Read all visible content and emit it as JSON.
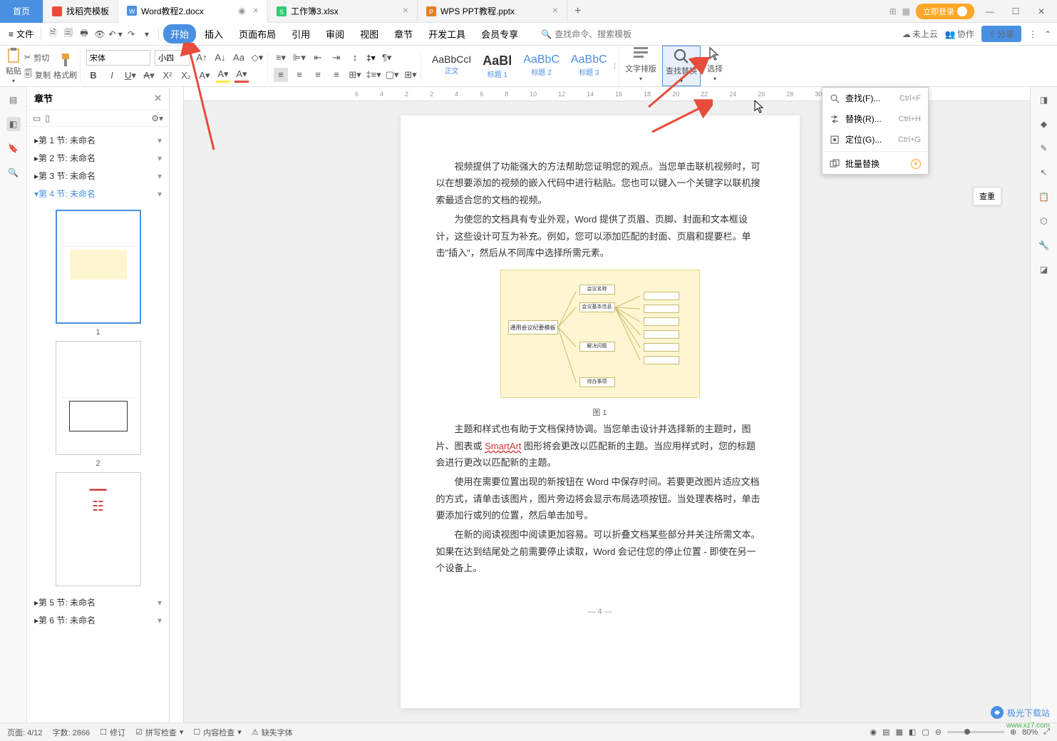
{
  "titlebar": {
    "home": "首页",
    "tabs": [
      {
        "label": "找稻壳模板",
        "icon": "#e74c3c"
      },
      {
        "label": "Word教程2.docx",
        "icon": "#4a90e2",
        "active": true
      },
      {
        "label": "工作簿3.xlsx",
        "icon": "#2ecc71"
      },
      {
        "label": "WPS PPT教程.pptx",
        "icon": "#e67e22"
      }
    ],
    "login": "立即登录"
  },
  "menubar": {
    "file": "文件",
    "tabs": [
      "开始",
      "插入",
      "页面布局",
      "引用",
      "审阅",
      "视图",
      "章节",
      "开发工具",
      "会员专享"
    ],
    "active_tab": "开始",
    "search_placeholder": "查找命令、搜索模板",
    "cloud": "未上云",
    "coop": "协作",
    "share": "分享"
  },
  "ribbon": {
    "paste": "粘贴",
    "cut": "剪切",
    "copy": "复制",
    "format_painter": "格式刷",
    "font_name": "宋体",
    "font_size": "小四",
    "styles": [
      {
        "preview": "AaBbCcI",
        "name": "正文"
      },
      {
        "preview": "AaBl",
        "name": "标题 1"
      },
      {
        "preview": "AaBbC",
        "name": "标题 2"
      },
      {
        "preview": "AaBbC",
        "name": "标题 3"
      }
    ],
    "text_layout": "文字排版",
    "find_replace": "查找替换",
    "select": "选择"
  },
  "dropdown": {
    "items": [
      {
        "icon": "search",
        "label": "查找(F)...",
        "shortcut": "Ctrl+F"
      },
      {
        "icon": "replace",
        "label": "替换(R)...",
        "shortcut": "Ctrl+H"
      },
      {
        "icon": "goto",
        "label": "定位(G)...",
        "shortcut": "Ctrl+G"
      },
      {
        "icon": "batch",
        "label": "批量替换",
        "badge": true
      }
    ]
  },
  "sidebar": {
    "title": "章节",
    "sections": [
      "第 1 节: 未命名",
      "第 2 节: 未命名",
      "第 3 节: 未命名",
      "第 4 节: 未命名",
      "第 5 节: 未命名",
      "第 6 节: 未命名"
    ],
    "active_section": 3,
    "thumbs": [
      1,
      2
    ]
  },
  "ruler": [
    "6",
    "4",
    "2",
    "",
    "2",
    "4",
    "6",
    "8",
    "10",
    "12",
    "14",
    "16",
    "18",
    "20",
    "22",
    "24",
    "26",
    "28",
    "30",
    "32",
    "34"
  ],
  "document": {
    "p1": "视频提供了功能强大的方法帮助您证明您的观点。当您单击联机视频时，可以在想要添加的视频的嵌入代码中进行粘贴。您也可以键入一个关键字以联机搜索最适合您的文档的视频。",
    "p2": "为使您的文档具有专业外观，Word 提供了页眉、页脚、封面和文本框设计，这些设计可互为补充。例如，您可以添加匹配的封面、页眉和提要栏。单击\"插入\"，然后从不同库中选择所需元素。",
    "caption": "图 1",
    "p3_a": "主题和样式也有助于文档保持协调。当您单击设计并选择新的主题时，图片、图表或 ",
    "p3_smartart": "SmartArt",
    "p3_b": " 图形将会更改以匹配新的主题。当应用样式时，您的标题会进行更改以匹配新的主题。",
    "p4": "使用在需要位置出现的新按钮在 Word 中保存时间。若要更改图片适应文档的方式，请单击该图片，图片旁边将会显示布局选项按钮。当处理表格时，单击要添加行或列的位置，然后单击加号。",
    "p5": "在新的阅读视图中阅读更加容易。可以折叠文档某些部分并关注所需文本。如果在达到结尾处之前需要停止读取，Word 会记住您的停止位置 - 即使在另一个设备上。",
    "page_num": "— 4 —"
  },
  "check_panel": "查重",
  "statusbar": {
    "page": "页面: 4/12",
    "words": "字数: 2866",
    "revision": "修订",
    "spell": "拼写检查",
    "content": "内容检查",
    "missing_font": "缺失字体",
    "zoom": "80%"
  },
  "watermark": {
    "main": "极光下载站",
    "sub": "www.xz7.com"
  }
}
